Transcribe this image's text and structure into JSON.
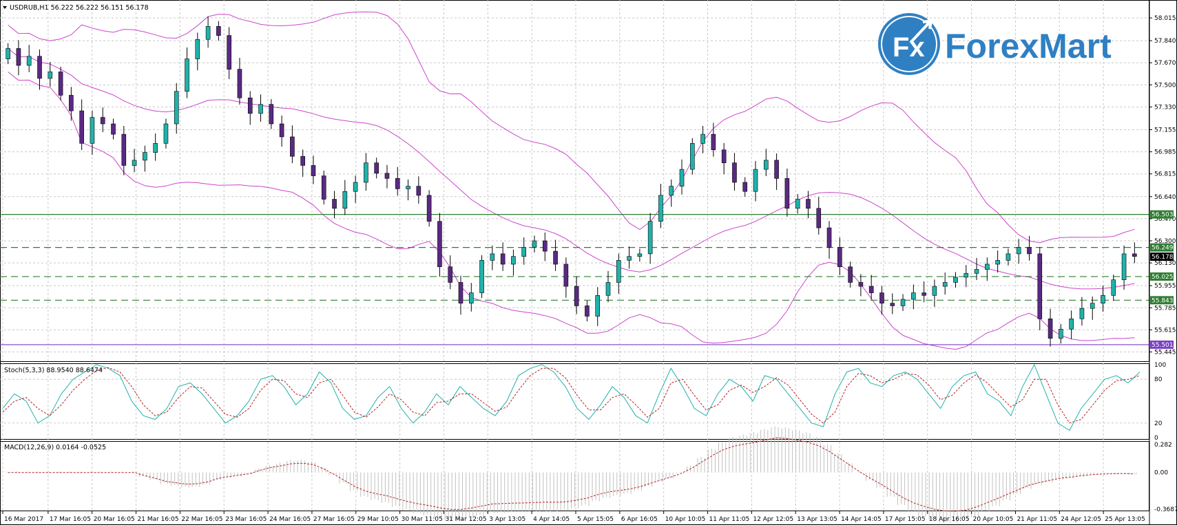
{
  "header": {
    "symbol_line": "USDRUB,H1  56.222 56.222 56.151 56.178"
  },
  "logo": {
    "mark": "Fx",
    "name": "ForexMart",
    "brand_color": "#2f80c3"
  },
  "colors": {
    "bull": "#20b2aa",
    "bear": "#5a2a82",
    "bands": "#cc44cc",
    "grid": "#c8c8c8",
    "level_green": "#2e7d32",
    "level_purple": "#7b3fc4",
    "stoch_main": "#20b2aa",
    "stoch_signal": "#b22222",
    "macd_hist": "#c0c0c0",
    "macd_signal": "#b22222"
  },
  "price_axis": {
    "ticks": [
      "58.015",
      "57.840",
      "57.670",
      "57.500",
      "57.330",
      "57.155",
      "56.985",
      "56.815",
      "56.640",
      "56.470",
      "56.300",
      "56.130",
      "55.955",
      "55.785",
      "55.615",
      "55.445"
    ]
  },
  "time_axis": {
    "labels": [
      "16 Mar 2017",
      "17 Mar 16:05",
      "20 Mar 16:05",
      "21 Mar 16:05",
      "22 Mar 16:05",
      "23 Mar 16:05",
      "24 Mar 16:05",
      "27 Mar 16:05",
      "29 Mar 10:05",
      "30 Mar 11:05",
      "31 Mar 12:05",
      "3 Apr 13:05",
      "4 Apr 14:05",
      "5 Apr 15:05",
      "6 Apr 16:05",
      "10 Apr 10:05",
      "11 Apr 11:05",
      "12 Apr 12:05",
      "13 Apr 13:05",
      "14 Apr 14:05",
      "17 Apr 15:05",
      "18 Apr 16:05",
      "20 Apr 10:05",
      "21 Apr 11:05",
      "24 Apr 12:05",
      "25 Apr 13:05"
    ]
  },
  "levels": [
    {
      "label": "56.503",
      "style": "solid",
      "color": "#2e7d32"
    },
    {
      "label": "56.249",
      "style": "dashed",
      "color": "#2e7d32"
    },
    {
      "label": "56.025",
      "style": "dashed",
      "color": "#2e7d32"
    },
    {
      "label": "55.843",
      "style": "dashed",
      "color": "#2e7d32"
    },
    {
      "label": "55.501",
      "style": "solid",
      "color": "#7b3fc4"
    }
  ],
  "current_price": {
    "label": "56.178"
  },
  "stoch": {
    "label": "Stoch(5,3,3) 88.9540 88.6474",
    "ticks": [
      "100",
      "80",
      "20",
      "0"
    ]
  },
  "macd": {
    "label": "MACD(12,26,9) 0.0164 -0.0525",
    "ticks": [
      "0.282",
      "0.00",
      "-0.3687"
    ]
  },
  "chart_data": {
    "type": "candlestick",
    "symbol": "USDRUB",
    "timeframe": "H1",
    "ohlc_last": {
      "open": 56.222,
      "high": 56.222,
      "low": 56.151,
      "close": 56.178
    },
    "ylim": [
      55.4,
      58.1
    ],
    "closes": [
      57.78,
      57.65,
      57.72,
      57.55,
      57.6,
      57.42,
      57.3,
      57.05,
      57.25,
      57.2,
      57.12,
      56.88,
      56.92,
      56.98,
      57.05,
      57.2,
      57.45,
      57.7,
      57.85,
      57.95,
      57.88,
      57.62,
      57.4,
      57.28,
      57.35,
      57.2,
      57.1,
      56.95,
      56.88,
      56.8,
      56.62,
      56.55,
      56.68,
      56.75,
      56.9,
      56.82,
      56.78,
      56.7,
      56.72,
      56.65,
      56.45,
      56.1,
      55.98,
      55.82,
      55.9,
      56.15,
      56.2,
      56.12,
      56.18,
      56.25,
      56.3,
      56.22,
      56.12,
      55.95,
      55.8,
      55.72,
      55.88,
      55.98,
      56.15,
      56.18,
      56.2,
      56.45,
      56.65,
      56.72,
      56.85,
      57.05,
      57.12,
      57.0,
      56.9,
      56.75,
      56.68,
      56.85,
      56.92,
      56.78,
      56.55,
      56.62,
      56.55,
      56.4,
      56.25,
      56.1,
      55.98,
      55.95,
      55.9,
      55.82,
      55.8,
      55.85,
      55.9,
      55.88,
      55.95,
      55.98,
      56.02,
      56.05,
      56.08,
      56.12,
      56.15,
      56.2,
      56.25,
      56.2,
      55.7,
      55.55,
      55.62,
      55.7,
      55.78,
      55.82,
      55.88,
      56.0,
      56.2,
      56.18
    ],
    "stoch_main": [
      40,
      60,
      50,
      20,
      30,
      60,
      80,
      90,
      100,
      95,
      85,
      50,
      30,
      25,
      40,
      70,
      75,
      60,
      40,
      20,
      30,
      50,
      80,
      85,
      70,
      45,
      60,
      90,
      75,
      40,
      25,
      30,
      55,
      70,
      40,
      20,
      35,
      60,
      45,
      70,
      55,
      40,
      30,
      50,
      85,
      95,
      100,
      90,
      70,
      40,
      25,
      45,
      70,
      55,
      30,
      20,
      60,
      95,
      70,
      40,
      30,
      60,
      80,
      70,
      50,
      85,
      80,
      60,
      40,
      20,
      15,
      60,
      90,
      95,
      75,
      70,
      85,
      90,
      80,
      60,
      40,
      70,
      85,
      90,
      60,
      50,
      30,
      70,
      100,
      60,
      20,
      10,
      40,
      60,
      80,
      85,
      75,
      90
    ],
    "stoch_signal": [
      35,
      50,
      55,
      40,
      30,
      45,
      65,
      80,
      92,
      96,
      90,
      70,
      45,
      30,
      35,
      55,
      70,
      68,
      50,
      32,
      28,
      40,
      65,
      80,
      78,
      60,
      55,
      75,
      80,
      58,
      35,
      28,
      42,
      60,
      52,
      35,
      30,
      48,
      50,
      60,
      60,
      48,
      36,
      42,
      65,
      85,
      95,
      95,
      82,
      58,
      38,
      38,
      55,
      60,
      45,
      28,
      40,
      75,
      80,
      58,
      38,
      45,
      65,
      72,
      62,
      70,
      82,
      72,
      52,
      32,
      20,
      35,
      70,
      88,
      85,
      75,
      80,
      88,
      86,
      72,
      52,
      58,
      75,
      86,
      75,
      58,
      42,
      52,
      80,
      80,
      45,
      20,
      25,
      45,
      65,
      78,
      80,
      85
    ],
    "macd_hist_shape": "negative -> positive -> negative -> positive -> negative -> slightly positive",
    "legend_position": "top-left"
  }
}
